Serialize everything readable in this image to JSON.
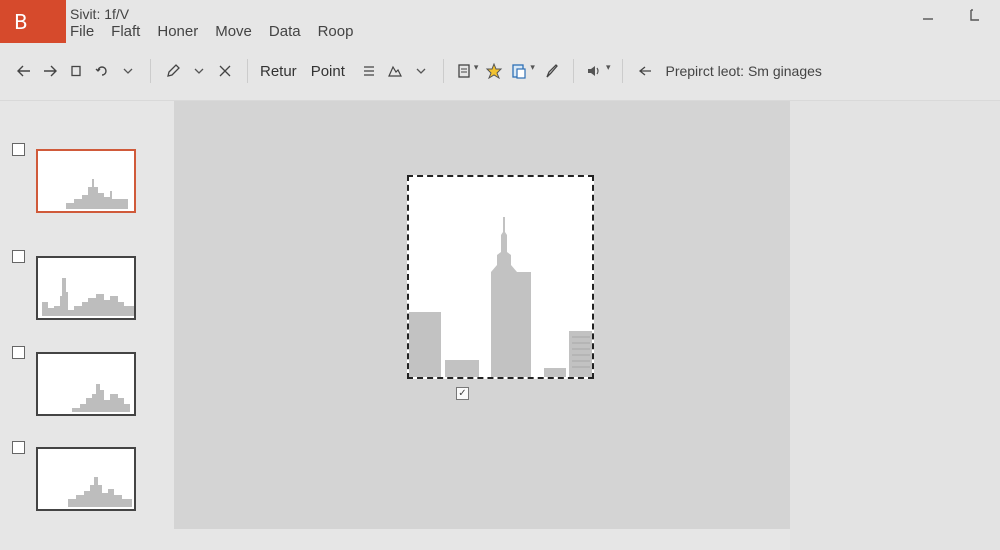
{
  "app": {
    "logo_letter": "B",
    "window_title": "Sivit: 1f/V"
  },
  "menu": [
    "File",
    "Flaft",
    "Honer",
    "Move",
    "Data",
    "Roop"
  ],
  "window_controls": [
    "minimize-icon",
    "restore-icon"
  ],
  "toolbar": {
    "text_buttons": [
      "Retur",
      "Point"
    ],
    "search_text": "Prepirct leot: Sm ginages"
  },
  "thumbnails": [
    {
      "checked": false,
      "selected": true
    },
    {
      "checked": false,
      "selected": false
    },
    {
      "checked": false,
      "selected": false
    },
    {
      "checked": false,
      "selected": false
    }
  ],
  "slide": {
    "checkbox_checked": true
  },
  "colors": {
    "accent": "#d64a2c",
    "canvas": "#d4d4d4",
    "skyline": "#c2c2c2"
  }
}
